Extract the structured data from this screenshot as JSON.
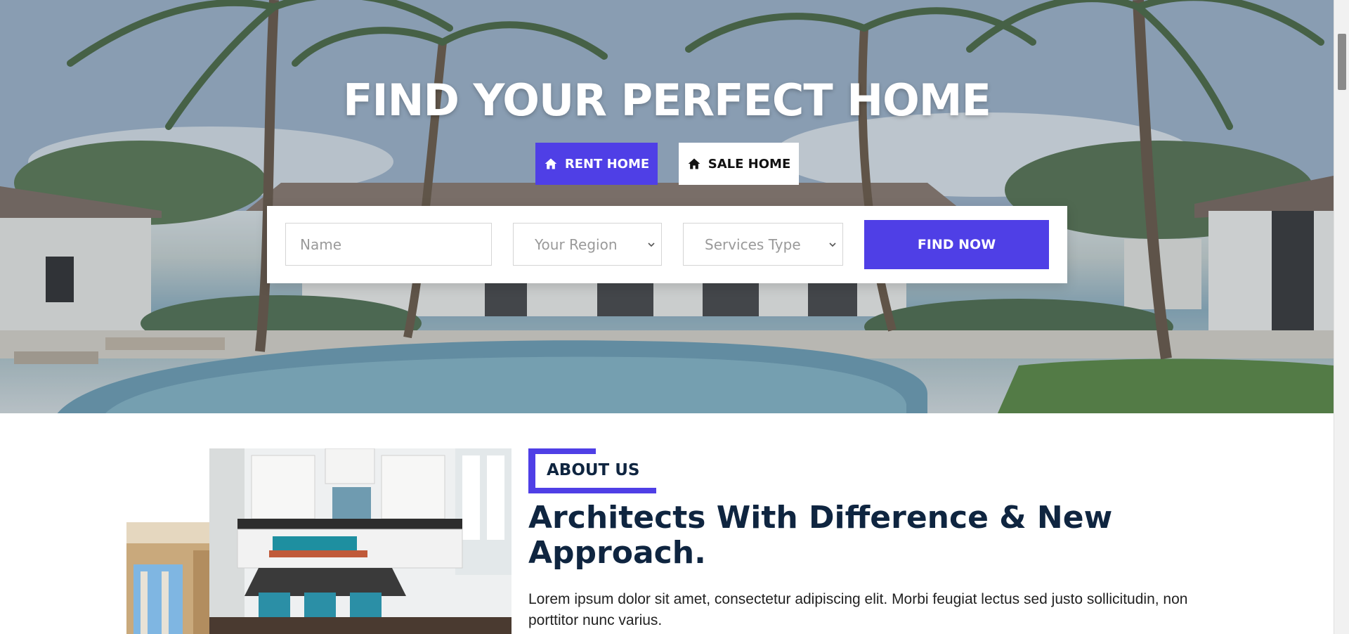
{
  "hero": {
    "title": "FIND YOUR PERFECT HOME",
    "tabs": [
      {
        "label": "RENT HOME",
        "icon": "home-icon",
        "active": true
      },
      {
        "label": "SALE HOME",
        "icon": "home-icon",
        "active": false
      }
    ],
    "search": {
      "name_placeholder": "Name",
      "region_selected": "Your Region",
      "service_selected": "Services Type",
      "button_label": "FIND NOW"
    }
  },
  "about": {
    "badge": "ABOUT US",
    "heading": "Architects With Difference & New Approach.",
    "text": "Lorem ipsum dolor sit amet, consectetur adipiscing elit. Morbi feugiat lectus sed justo sollicitudin, non porttitor nunc varius."
  },
  "colors": {
    "accent": "#4f3fe6",
    "heading": "#0f2540"
  }
}
